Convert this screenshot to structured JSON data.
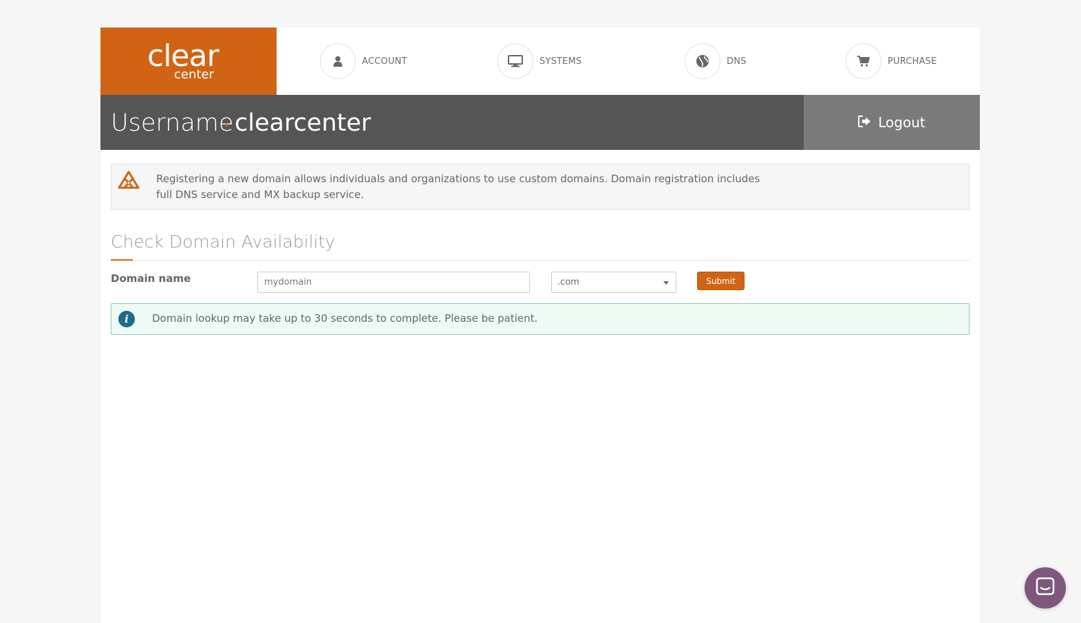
{
  "header": {
    "logo": {
      "main": "clear",
      "sub": "center"
    },
    "nav": [
      {
        "label": "ACCOUNT",
        "icon": "user-icon"
      },
      {
        "label": "SYSTEMS",
        "icon": "monitor-icon"
      },
      {
        "label": "DNS",
        "icon": "globe-icon"
      },
      {
        "label": "PURCHASE",
        "icon": "cart-icon"
      }
    ]
  },
  "titlebar": {
    "label": "Username",
    "name": "clearcenter",
    "logout_label": "Logout"
  },
  "notice": {
    "text": "Registering a new domain allows individuals and organizations to use custom domains. Domain registration includes full DNS service and MX backup service.",
    "icon": "clearos-warning-icon"
  },
  "form": {
    "section_title": "Check Domain Availability",
    "domain_label": "Domain name",
    "domain_placeholder": "mydomain",
    "tld_value": ".com",
    "submit_label": "Submit"
  },
  "info": {
    "text": "Domain lookup may take up to 30 seconds to complete. Please be patient.",
    "icon_glyph": "i"
  },
  "colors": {
    "brand_orange": "#d06414",
    "titlebar_bg": "#555555",
    "logout_bg": "#7a7a7a",
    "info_bg": "#eefaf4",
    "info_icon": "#1e6b8c",
    "chat_bg": "#7f577d"
  }
}
